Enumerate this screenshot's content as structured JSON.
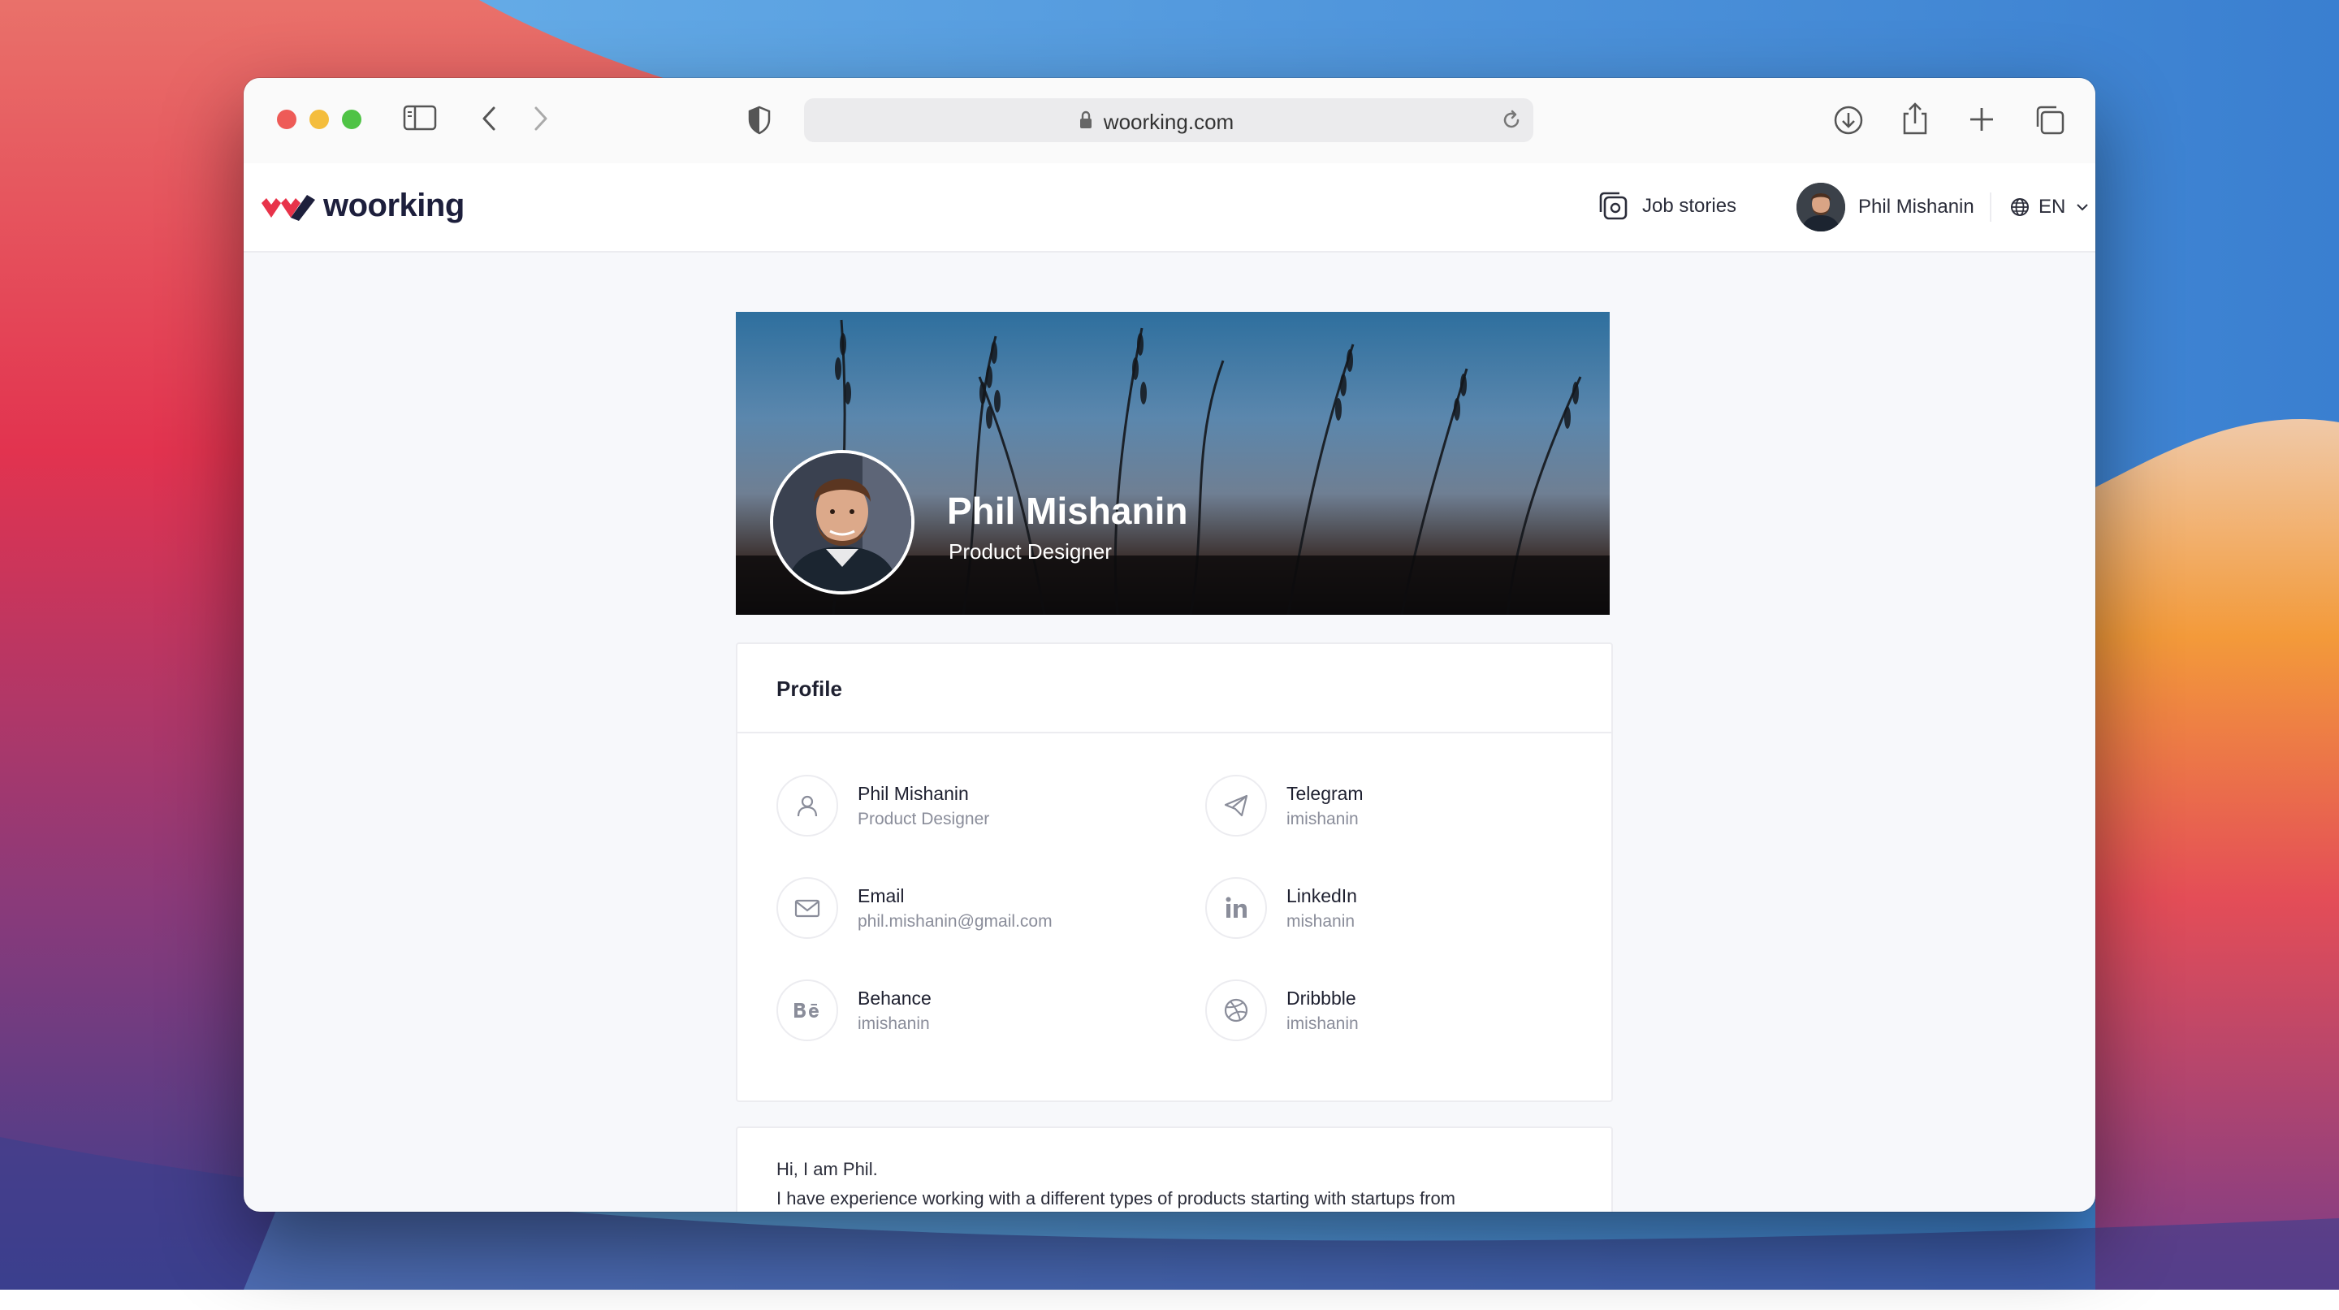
{
  "browser": {
    "url": "woorking.com",
    "colors": {
      "close": "#ee5b57",
      "minimize": "#f4bd3d",
      "zoom": "#4fc345"
    }
  },
  "site": {
    "logo_text": "woorking",
    "nav": {
      "job_stories": "Job stories",
      "user_name": "Phil Mishanin",
      "language": "EN"
    }
  },
  "cover": {
    "name": "Phil Mishanin",
    "role": "Product Designer"
  },
  "profile": {
    "title": "Profile",
    "items": [
      {
        "icon": "user-icon",
        "label": "Phil Mishanin",
        "value": "Product Designer"
      },
      {
        "icon": "telegram-icon",
        "label": "Telegram",
        "value": "imishanin"
      },
      {
        "icon": "mail-icon",
        "label": "Email",
        "value": "phil.mishanin@gmail.com"
      },
      {
        "icon": "linkedin-icon",
        "label": "LinkedIn",
        "value": "mishanin"
      },
      {
        "icon": "behance-icon",
        "label": "Behance",
        "value": "imishanin"
      },
      {
        "icon": "dribbble-icon",
        "label": "Dribbble",
        "value": "imishanin"
      }
    ]
  },
  "about": {
    "line1": "Hi, I am Phil.",
    "line2": "I have experience working with a different types of products starting with startups from"
  }
}
